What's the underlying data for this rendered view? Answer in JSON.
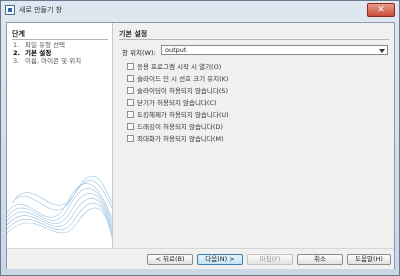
{
  "window": {
    "title": "새로 만들기 창",
    "close_glyph": "✕"
  },
  "steps": {
    "heading": "단계",
    "items": [
      {
        "num": "1.",
        "label": "파일 유형 선택"
      },
      {
        "num": "2.",
        "label": "기본 설정"
      },
      {
        "num": "3.",
        "label": "이름, 아이콘 및 위치"
      }
    ]
  },
  "main": {
    "section_title": "기본 설정",
    "position_label": "창 위치(W):",
    "position_value": "output",
    "options": [
      "응용 프로그램 시작 시 열기(O)",
      "슬라이드 인 시 선호 크기 유지(K)",
      "슬라이딩이 허용되지 않습니다(S)",
      "닫기가 허용되지 않습니다(C)",
      "도킹해제가 허용되지 않습니다(U)",
      "드래깅이 허용되지 않습니다(D)",
      "최대화가 허용되지 않습니다(M)"
    ]
  },
  "buttons": {
    "back": "< 뒤로(B)",
    "next": "다음(N) >",
    "finish": "마침(F)",
    "cancel": "취소",
    "help": "도움말(H)"
  },
  "colors": {
    "accent": "#2b66b8",
    "wave": "#7fb2d8"
  }
}
